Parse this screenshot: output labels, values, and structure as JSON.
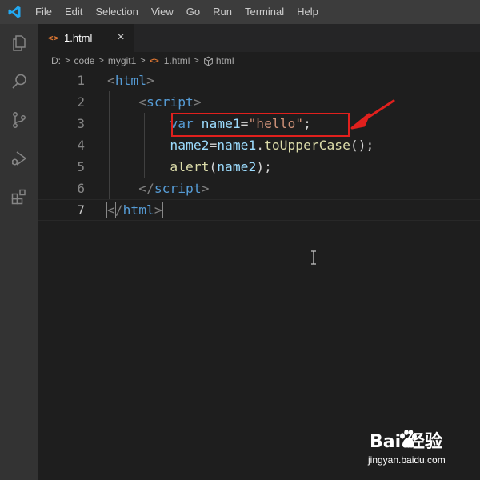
{
  "menubar": {
    "items": [
      "File",
      "Edit",
      "Selection",
      "View",
      "Go",
      "Run",
      "Terminal",
      "Help"
    ]
  },
  "activitybar": {
    "icons": [
      "files-icon",
      "search-icon",
      "source-control-icon",
      "run-debug-icon",
      "extensions-icon"
    ]
  },
  "tab": {
    "icon_text": "<>",
    "label": "1.html",
    "close_glyph": "×"
  },
  "breadcrumb": {
    "parts": [
      "D:",
      "code",
      "mygit1",
      "1.html",
      "html"
    ],
    "separator": ">",
    "file_icon_text": "<>"
  },
  "editor": {
    "line_numbers": [
      "1",
      "2",
      "3",
      "4",
      "5",
      "6",
      "7"
    ],
    "active_line": "7",
    "lines": [
      [
        {
          "t": "<",
          "c": "punct"
        },
        {
          "t": "html",
          "c": "tag"
        },
        {
          "t": ">",
          "c": "punct"
        }
      ],
      [
        {
          "t": "    ",
          "c": "op"
        },
        {
          "t": "<",
          "c": "punct"
        },
        {
          "t": "script",
          "c": "tag"
        },
        {
          "t": ">",
          "c": "punct"
        }
      ],
      [
        {
          "t": "        ",
          "c": "op"
        },
        {
          "t": "var",
          "c": "kw"
        },
        {
          "t": " ",
          "c": "op"
        },
        {
          "t": "name1",
          "c": "var"
        },
        {
          "t": "=",
          "c": "op"
        },
        {
          "t": "\"hello\"",
          "c": "str"
        },
        {
          "t": ";",
          "c": "op"
        }
      ],
      [
        {
          "t": "        ",
          "c": "op"
        },
        {
          "t": "name2",
          "c": "var"
        },
        {
          "t": "=",
          "c": "op"
        },
        {
          "t": "name1",
          "c": "var"
        },
        {
          "t": ".",
          "c": "op"
        },
        {
          "t": "toUpperCase",
          "c": "fn"
        },
        {
          "t": "();",
          "c": "op"
        }
      ],
      [
        {
          "t": "        ",
          "c": "op"
        },
        {
          "t": "alert",
          "c": "fn"
        },
        {
          "t": "(",
          "c": "op"
        },
        {
          "t": "name2",
          "c": "var"
        },
        {
          "t": ");",
          "c": "op"
        }
      ],
      [
        {
          "t": "    ",
          "c": "op"
        },
        {
          "t": "</",
          "c": "punct"
        },
        {
          "t": "script",
          "c": "tag"
        },
        {
          "t": ">",
          "c": "punct"
        }
      ],
      [
        {
          "t": "<",
          "c": "punct"
        },
        {
          "t": "/",
          "c": "punct"
        },
        {
          "t": "html",
          "c": "tag"
        },
        {
          "t": ">",
          "c": "punct"
        }
      ]
    ]
  },
  "annotation": {
    "highlight_color": "#e0201d"
  },
  "colors": {
    "titlebar": "#3c3c3c",
    "activitybar": "#333333",
    "editor_bg": "#1e1e1e",
    "tab_inactive_bg": "#252526",
    "accent_logo": "#23a9f2"
  },
  "watermark": {
    "brand": "Bai 经验",
    "url": "jingyan.baidu.com"
  }
}
